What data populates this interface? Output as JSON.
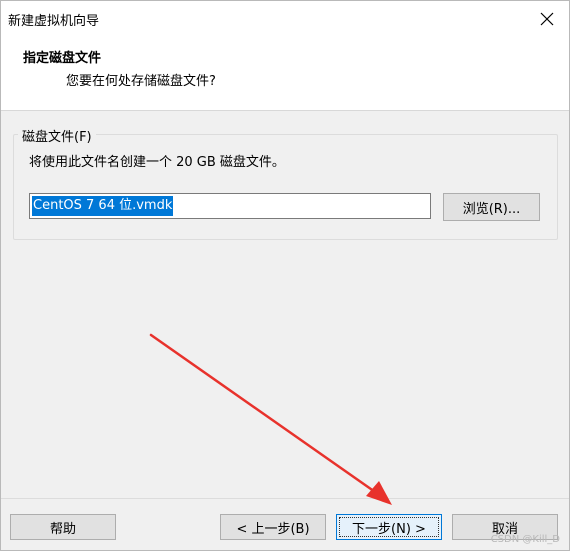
{
  "window": {
    "title": "新建虚拟机向导"
  },
  "header": {
    "title": "指定磁盘文件",
    "subtitle": "您要在何处存储磁盘文件?"
  },
  "disk_file": {
    "group_label": "磁盘文件(F)",
    "description": "将使用此文件名创建一个 20 GB 磁盘文件。",
    "filename_value": "CentOS 7 64 位.vmdk",
    "browse_label": "浏览(R)..."
  },
  "footer": {
    "help_label": "帮助",
    "back_label": "< 上一步(B)",
    "next_label": "下一步(N) >",
    "cancel_label": "取消"
  },
  "watermark": "CSDN @Kill_D",
  "colors": {
    "selection": "#0078d7",
    "arrow": "#e8322c"
  },
  "icons": {
    "close": "close-icon",
    "arrow": "red-arrow-annotation"
  }
}
